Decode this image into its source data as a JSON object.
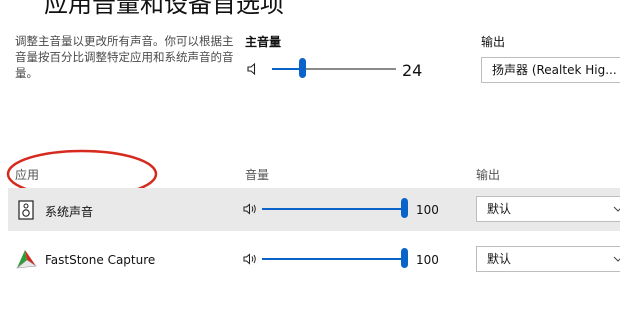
{
  "page": {
    "title": "应用音量和设备首选项",
    "description": "调整主音量以更改所有声音。你可以根据主音量按百分比调整特定应用和系统声音的音量。"
  },
  "master": {
    "label": "主音量",
    "volume_value": "24",
    "volume_level": 0.24,
    "output_label": "输出",
    "output_device": "扬声器 (Realtek Hig..."
  },
  "table": {
    "columns": {
      "app": "应用",
      "volume": "音量",
      "output": "输出"
    },
    "rows": [
      {
        "name": "系统声音",
        "icon": "system-sounds-icon",
        "volume_value": "100",
        "volume_level": 1.0,
        "output": "默认"
      },
      {
        "name": "FastStone Capture",
        "icon": "faststone-capture-icon",
        "volume_value": "100",
        "volume_level": 1.0,
        "output": "默认"
      }
    ]
  },
  "colors": {
    "accent": "#0a63c9",
    "annotation": "#d62a1f",
    "row_highlight": "#e9e9e9"
  }
}
